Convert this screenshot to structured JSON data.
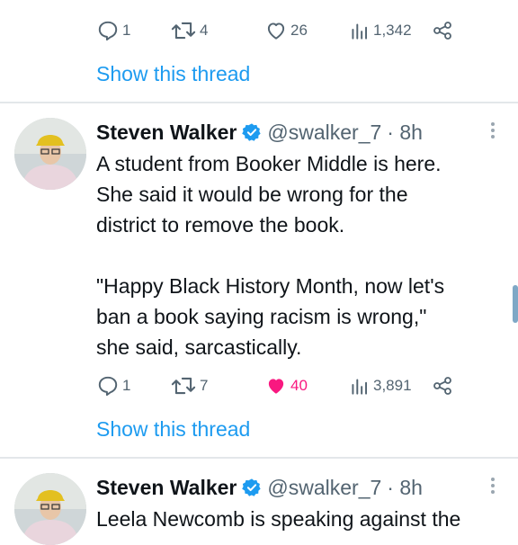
{
  "tweet_top": {
    "actions": {
      "replies": "1",
      "retweets": "4",
      "likes": "26",
      "views": "1,342"
    },
    "show_thread": "Show this thread"
  },
  "tweet_1": {
    "name": "Steven Walker",
    "handle": "@swalker_7",
    "time": "· 8h",
    "text": "A student from Booker Middle is here.\nShe said it would be wrong for the\ndistrict to remove the book.\n\n\"Happy Black History Month, now let's\nban a book saying racism is wrong,\"\nshe said, sarcastically.",
    "actions": {
      "replies": "1",
      "retweets": "7",
      "likes": "40",
      "views": "3,891"
    },
    "liked": true,
    "show_thread": "Show this thread"
  },
  "tweet_2": {
    "name": "Steven Walker",
    "handle": "@swalker_7",
    "time": "· 8h",
    "text": "Leela Newcomb is speaking against the"
  },
  "colors": {
    "link": "#1d9bf0",
    "like_active": "#f91880",
    "verified": "#1d9bf0",
    "muted": "#536471"
  },
  "icons": [
    "reply-icon",
    "retweet-icon",
    "like-icon",
    "views-icon",
    "share-icon",
    "verified-badge-icon",
    "more-icon"
  ]
}
